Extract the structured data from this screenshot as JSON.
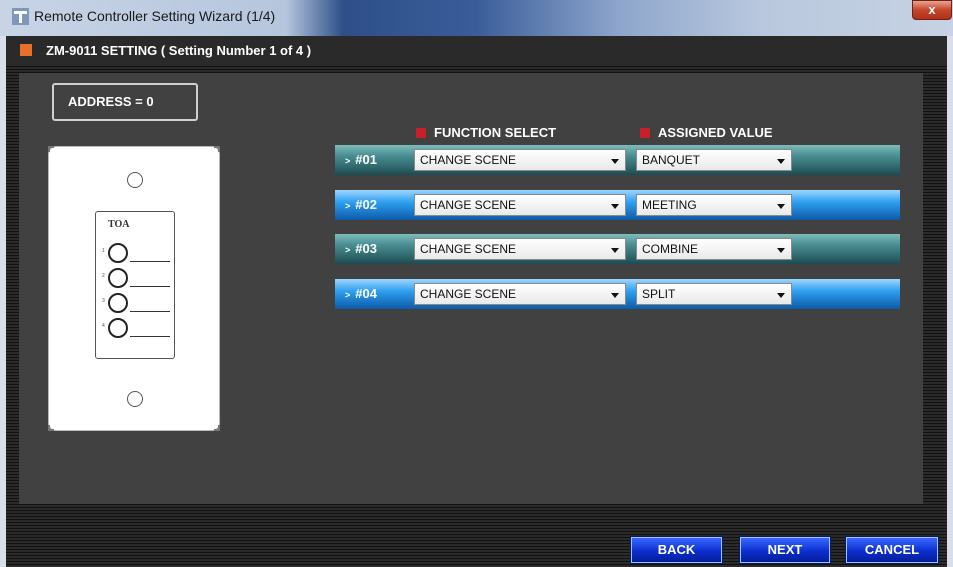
{
  "window": {
    "title": "Remote Controller Setting Wizard (1/4)",
    "close_label": "x"
  },
  "header": {
    "title": "ZM-9011 SETTING  ( Setting Number 1 of 4 )",
    "accent_color": "#e8702a"
  },
  "address": {
    "label": "ADDRESS = 0"
  },
  "device": {
    "logo": "TOA",
    "key_numbers": [
      "1",
      "2",
      "3",
      "4"
    ]
  },
  "columns": {
    "function_select": "FUNCTION SELECT",
    "assigned_value": "ASSIGNED VALUE",
    "marker_color": "#c8202a"
  },
  "rows": [
    {
      "label": "#01",
      "function": "CHANGE SCENE",
      "value": "BANQUET",
      "style": "teal"
    },
    {
      "label": "#02",
      "function": "CHANGE SCENE",
      "value": "MEETING",
      "style": "blue"
    },
    {
      "label": "#03",
      "function": "CHANGE SCENE",
      "value": "COMBINE",
      "style": "teal"
    },
    {
      "label": "#04",
      "function": "CHANGE SCENE",
      "value": "SPLIT",
      "style": "blue"
    }
  ],
  "footer": {
    "back_label": "BACK",
    "next_label": "NEXT",
    "cancel_label": "CANCEL"
  }
}
